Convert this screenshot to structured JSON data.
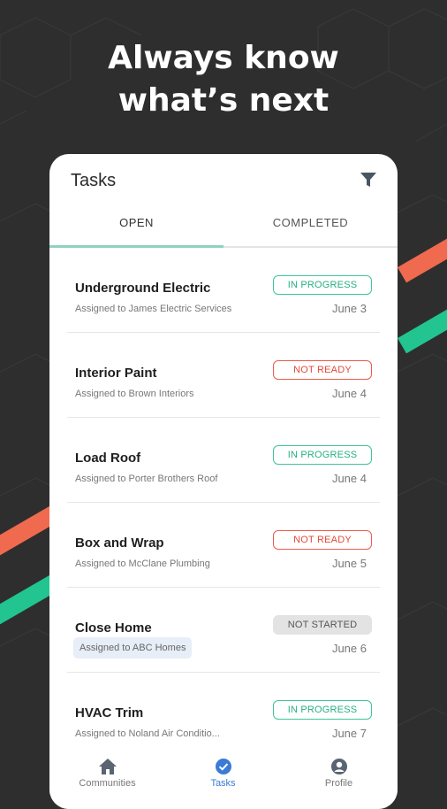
{
  "headline": {
    "line1": "Always know",
    "line2": "what’s next"
  },
  "colors": {
    "background": "#2e2e2e",
    "stripe_red": "#f06a4f",
    "stripe_green": "#22c48f",
    "accent_blue": "#3a7bd5",
    "in_progress": "#27b07f",
    "not_ready": "#e24a3c"
  },
  "app": {
    "title": "Tasks",
    "filter_icon": "filter-icon",
    "tabs": [
      {
        "label": "OPEN",
        "selected": true
      },
      {
        "label": "COMPLETED",
        "selected": false
      }
    ]
  },
  "tasks": [
    {
      "name": "Underground Electric",
      "assigned": "Assigned to James Electric Services",
      "status": "IN PROGRESS",
      "date": "June 3"
    },
    {
      "name": "Interior Paint",
      "assigned": "Assigned to Brown Interiors",
      "status": "NOT READY",
      "date": "June 4"
    },
    {
      "name": "Load Roof",
      "assigned": "Assigned to Porter Brothers Roof",
      "status": "IN PROGRESS",
      "date": "June 4"
    },
    {
      "name": "Box and Wrap",
      "assigned": "Assigned to McClane Plumbing",
      "status": "NOT READY",
      "date": "June 5"
    },
    {
      "name": "Close Home",
      "assigned": "Assigned to ABC Homes",
      "status": "NOT STARTED",
      "date": "June 6"
    },
    {
      "name": "HVAC Trim",
      "assigned": "Assigned to Noland Air Conditio...",
      "status": "IN PROGRESS",
      "date": "June 7"
    }
  ],
  "bottom_nav": [
    {
      "label": "Communities",
      "icon": "home-icon",
      "active": false
    },
    {
      "label": "Tasks",
      "icon": "check-circle-icon",
      "active": true
    },
    {
      "label": "Profile",
      "icon": "user-icon",
      "active": false
    }
  ]
}
